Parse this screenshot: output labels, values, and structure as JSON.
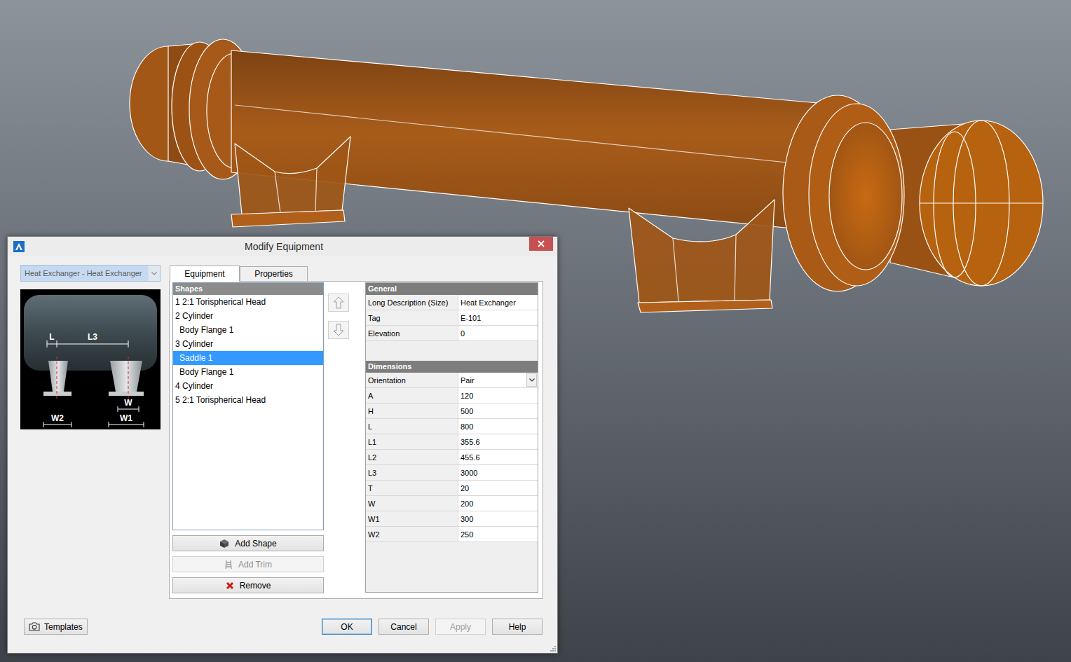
{
  "window": {
    "title": "Modify Equipment"
  },
  "equipment_class": {
    "value": "Heat Exchanger - Heat Exchanger",
    "disabled": true
  },
  "preview": {
    "l": "L",
    "l3": "L3",
    "w": "W",
    "w2": "W2",
    "w1": "W1"
  },
  "tabs": [
    {
      "label": "Equipment",
      "selected": true
    },
    {
      "label": "Properties",
      "selected": false
    }
  ],
  "shapes": {
    "header": "Shapes",
    "items": [
      {
        "label": "1 2:1 Torispherical Head",
        "child": false,
        "selected": false
      },
      {
        "label": "2 Cylinder",
        "child": false,
        "selected": false
      },
      {
        "label": "Body Flange 1",
        "child": true,
        "selected": false
      },
      {
        "label": "3 Cylinder",
        "child": false,
        "selected": false
      },
      {
        "label": "Saddle 1",
        "child": true,
        "selected": true
      },
      {
        "label": "Body Flange 1",
        "child": true,
        "selected": false
      },
      {
        "label": "4 Cylinder",
        "child": false,
        "selected": false
      },
      {
        "label": "5 2:1 Torispherical Head",
        "child": false,
        "selected": false
      }
    ]
  },
  "shape_buttons": [
    {
      "label": "Add Shape",
      "kind": "add",
      "disabled": false
    },
    {
      "label": "Add Trim",
      "kind": "trim",
      "disabled": true
    },
    {
      "label": "Remove",
      "kind": "remove",
      "disabled": false
    }
  ],
  "general": {
    "header": "General",
    "rows": [
      {
        "label": "Long Description (Size)",
        "value": "Heat Exchanger"
      },
      {
        "label": "Tag",
        "value": "E-101"
      },
      {
        "label": "Elevation",
        "value": "0"
      }
    ]
  },
  "dimensions": {
    "header": "Dimensions",
    "orientation": {
      "label": "Orientation",
      "value": "Pair"
    },
    "rows": [
      {
        "label": "A",
        "value": "120"
      },
      {
        "label": "H",
        "value": "500"
      },
      {
        "label": "L",
        "value": "800"
      },
      {
        "label": "L1",
        "value": "355.6"
      },
      {
        "label": "L2",
        "value": "455.6"
      },
      {
        "label": "L3",
        "value": "3000"
      },
      {
        "label": "T",
        "value": "20"
      },
      {
        "label": "W",
        "value": "200"
      },
      {
        "label": "W1",
        "value": "300"
      },
      {
        "label": "W2",
        "value": "250"
      }
    ]
  },
  "templates_button": {
    "label": "Templates"
  },
  "buttons": [
    {
      "label": "OK",
      "default": true,
      "disabled": false
    },
    {
      "label": "Cancel",
      "default": false,
      "disabled": false
    },
    {
      "label": "Apply",
      "default": false,
      "disabled": true
    },
    {
      "label": "Help",
      "default": false,
      "disabled": false
    }
  ]
}
